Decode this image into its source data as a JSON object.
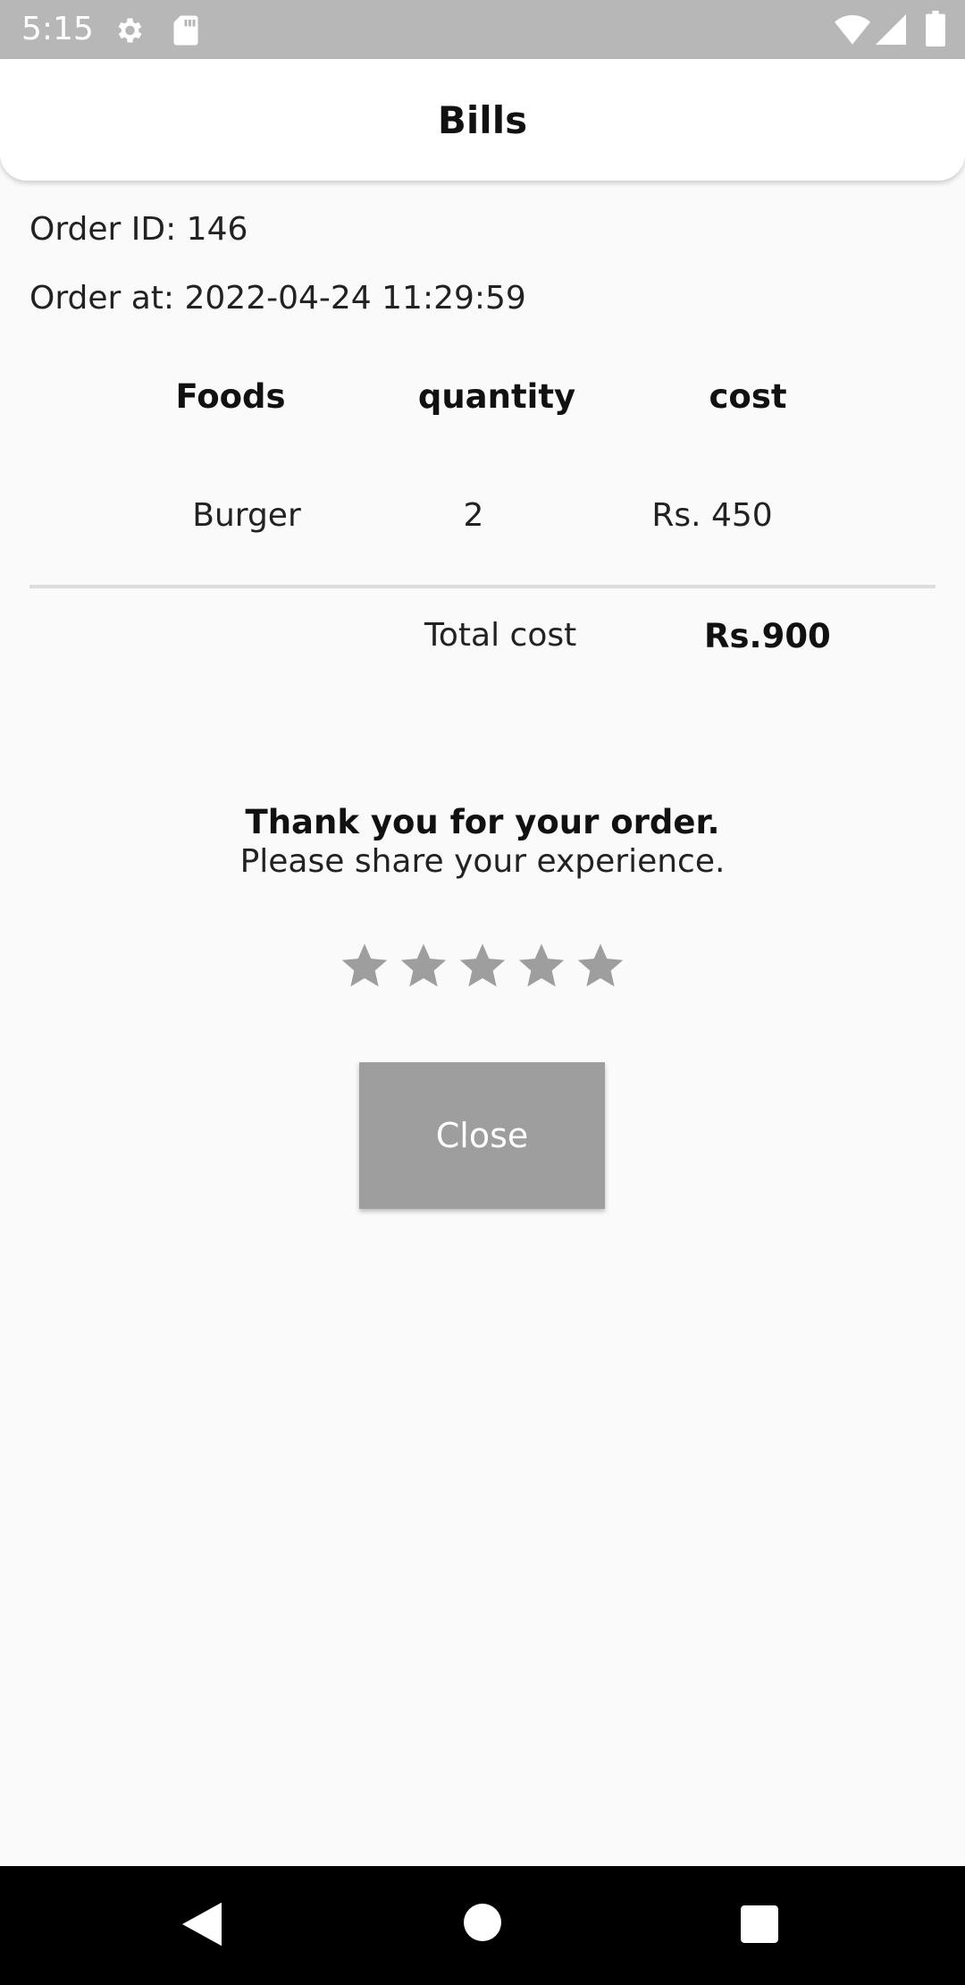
{
  "status_bar": {
    "time": "5:15",
    "icons": [
      "gear-icon",
      "sd-card-icon",
      "wifi-icon",
      "signal-icon",
      "battery-icon"
    ]
  },
  "app_bar": {
    "title": "Bills"
  },
  "order": {
    "id_text": "Order ID: 146",
    "time_text": "Order at: 2022-04-24 11:29:59"
  },
  "table": {
    "headers": [
      "Foods",
      "quantity",
      "cost"
    ],
    "rows": [
      {
        "food": "Burger",
        "quantity": "2",
        "cost": "Rs. 450"
      }
    ],
    "total_label": "Total cost",
    "total_value": "Rs.900"
  },
  "feedback": {
    "thanks": "Thank you for your order.",
    "prompt": "Please share your experience.",
    "rating": 0,
    "max_rating": 5,
    "star_color": "#9e9e9e"
  },
  "close_label": "Close",
  "colors": {
    "status_bar": "#b7b7b7",
    "background": "#fafafa",
    "button": "#9e9e9e",
    "nav_bar": "#000000"
  }
}
